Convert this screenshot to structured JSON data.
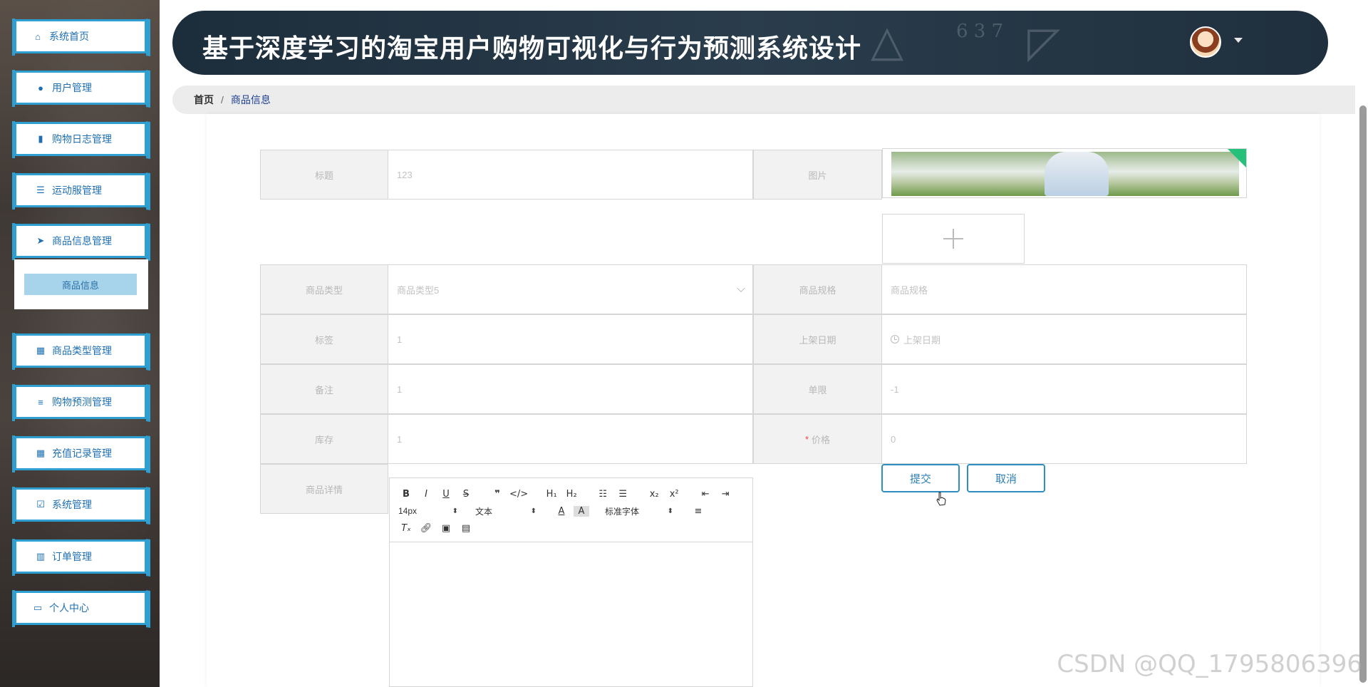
{
  "header": {
    "title": "基于深度学习的淘宝用户购物可视化与行为预测系统设计"
  },
  "sidebar": {
    "items": [
      {
        "label": "系统首页",
        "icon": "home-icon"
      },
      {
        "label": "用户管理",
        "icon": "bulb-icon"
      },
      {
        "label": "购物日志管理",
        "icon": "clipboard-icon"
      },
      {
        "label": "运动服管理",
        "icon": "list-icon"
      },
      {
        "label": "商品信息管理",
        "icon": "send-icon"
      },
      {
        "label": "商品类型管理",
        "icon": "grid-icon"
      },
      {
        "label": "购物预测管理",
        "icon": "lines-icon"
      },
      {
        "label": "充值记录管理",
        "icon": "grid-icon"
      },
      {
        "label": "系统管理",
        "icon": "check-clipboard-icon"
      },
      {
        "label": "订单管理",
        "icon": "bar-chart-icon"
      },
      {
        "label": "个人中心",
        "icon": "card-icon"
      }
    ],
    "submenu": {
      "label": "商品信息"
    }
  },
  "breadcrumb": {
    "home": "首页",
    "separator": "/",
    "current": "商品信息"
  },
  "form": {
    "title_label": "标题",
    "title_value": "123",
    "image_label": "图片",
    "type_label": "商品类型",
    "type_value": "商品类型5",
    "spec_label": "商品规格",
    "spec_value": "商品规格",
    "tag_label": "标签",
    "tag_value": "1",
    "date_label": "上架日期",
    "date_value": "上架日期",
    "note_label": "备注",
    "note_value": "1",
    "limit_label": "单限",
    "limit_value": "-1",
    "stock_label": "库存",
    "stock_value": "1",
    "price_required": "*",
    "price_label": "价格",
    "price_value": "0",
    "detail_label": "商品详情"
  },
  "buttons": {
    "submit": "提交",
    "cancel": "取消"
  },
  "editor": {
    "font_size": "14px",
    "text_style": "文本",
    "font_family": "标准字体"
  },
  "watermark": "CSDN @QQ_1795806396"
}
